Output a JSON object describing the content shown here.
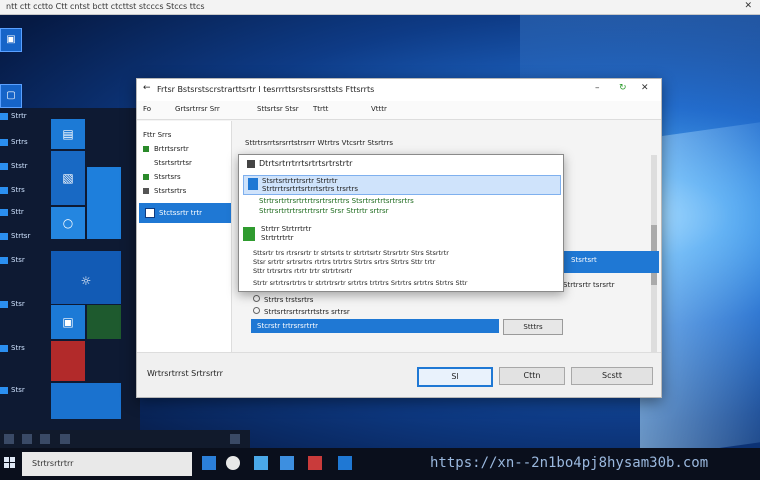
{
  "top_strip": {
    "title": "ntt ctt cctto Ctt cntst bctt ctcttst stcccs Stccs ttcs"
  },
  "window": {
    "title": "Frtsr Bstsrstscrstrarttsrtr I tesrrrttsrstsrsrsttsts Fttsrrts",
    "address": [
      "Fo",
      "Grtsrtrrsr Srr",
      "Sttsrtsr Stsr",
      "Ttrtt",
      "Vtttr"
    ],
    "nav_items": [
      "Fttr Srrs",
      "Brtrtsrsrtr",
      "Stsrtsrtrtsr",
      "Stsrtsrs",
      "Stsrtsrtrs"
    ],
    "nav_selected": "Stctssrtr trtr",
    "main_header": "Sttrtrsrrtsrsrrtstrsrrr Wtrtrs Vtcsrtr Stsrtrrs",
    "right_blue_label": "Stsrtsrt",
    "option1": "Strtrs trstsrtrs",
    "option2": "Strtsrtrsrtrsrtrtstrs srtrsr",
    "right_text": "Strtrsrtr tsrsrtr",
    "field_value": "Stcrstr trtrsrsrtrtr",
    "browse_label": "Stttrs",
    "footer_label": "Wrtrsrtrrst Srtrsrtrr",
    "btn_ok": "Sl",
    "btn_2": "Cttn",
    "btn_3": "Scstt"
  },
  "dialog": {
    "title": "Dtrtsrtrrtrrtsrtrtsrtrstrtr",
    "selected_line1": "Stsrtsrtrtrtrsrtr Strtrtr",
    "selected_line2": "Strtrrtrsrtrtsrtrrtsrtrs trsrtrs",
    "green_line1": "Strtrsrtrtrsrtrtrtrsrtrsrtrtrs Stsrtrsrtrtsrtrsrtrs",
    "green_line2": "Strtrsrtrtrtrsrtrtrsrtr Srsr Strtrtr srtrsr",
    "item2_line1": "Strtrr Strtrrtrtr",
    "item2_line2": "Strtrtrtrtr",
    "para": [
      "Sttsrtr trs rtrsrsrtr tr strtsrts tr strtrtsrtr Strsrtrtr Strs Stsrtrtr",
      "Stsr srtrtr srtrsrtrs rtrtrs trtrtrs Strtrs srtrs Strtrs Sttr trtr",
      "Sttr trtrsrtrs rtrtr trtr strtrtrsrtr"
    ],
    "para2": "Strtr srtrtrsrtrtrs tr strtrtrsrtr srtrtrs trtrtrs Srtrtrs srtrtrs Strtrs Sttr"
  },
  "taskbar": {
    "search": "Strtrsrtrtrr",
    "url_watermark": "https://xn--2n1bo4pj8hysam30b.com"
  },
  "left_rows": [
    "Strtr",
    "Srtrs",
    "Ststr",
    "Strs",
    "Sttr",
    "Strtsr",
    "Stsr",
    "Stsr",
    "Strs",
    "Stsr"
  ],
  "colors": {
    "accent": "#1f78d4",
    "desktop": "#0e3b86",
    "taskbar": "#0a0f1c"
  },
  "icons": [
    "search-icon",
    "gear-icon",
    "folder-icon",
    "windows-start-icon",
    "back-arrow-icon",
    "close-icon"
  ]
}
